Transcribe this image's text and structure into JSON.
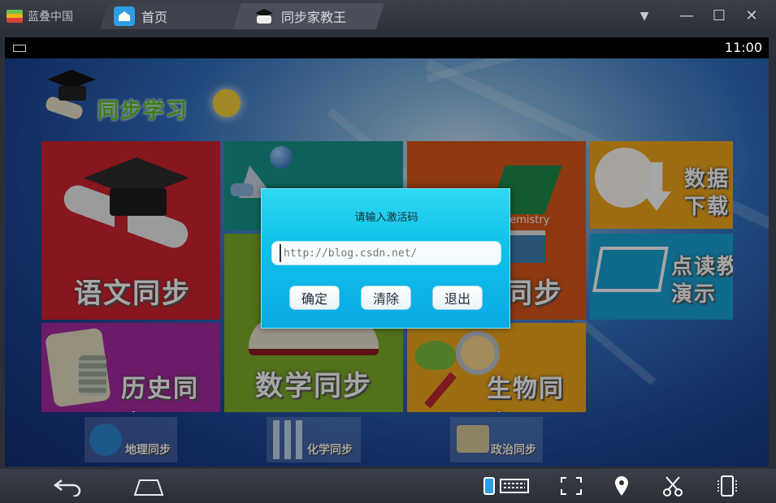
{
  "window": {
    "brand_label": "蓝叠中国",
    "tabs": [
      {
        "label": "首页",
        "icon": "home-icon"
      },
      {
        "label": "同步家教王",
        "icon": "graduation-cap-icon"
      }
    ],
    "controls": {
      "menu": "▼",
      "minimize": "—",
      "maximize": "☐",
      "close": "✕"
    }
  },
  "statusbar": {
    "time": "11:00"
  },
  "app": {
    "title": "同步学习",
    "tiles": {
      "yuwen": "语文同步",
      "chem_partial": "同步",
      "shuju": "数据\n下载",
      "diandu": "点读教\n演示",
      "math": "数学同步",
      "lishi": "历史同步",
      "shengwu": "生物同步",
      "chem_book": "hemistry"
    },
    "small_tiles": {
      "dili": "地理同步",
      "huaxue": "化学同步",
      "zhengzhi": "政治同步"
    }
  },
  "dialog": {
    "title": "请输入激活码",
    "input_placeholder": "http://blog.csdn.net/",
    "buttons": {
      "ok": "确定",
      "clear": "清除",
      "exit": "退出"
    }
  },
  "navbar": {
    "icons": [
      "back-icon",
      "home-icon",
      "keyboard-toggle-icon",
      "fullscreen-icon",
      "location-icon",
      "scissors-icon",
      "rotate-icon"
    ]
  },
  "colors": {
    "tile_red": "#d0222e",
    "tile_orange": "#d9561a",
    "tile_yellow": "#f1a81c",
    "tile_blue": "#19a3d6",
    "tile_green": "#7fae2a",
    "tile_purple": "#a72aa1",
    "dialog_cyan": "#10c2ea"
  }
}
